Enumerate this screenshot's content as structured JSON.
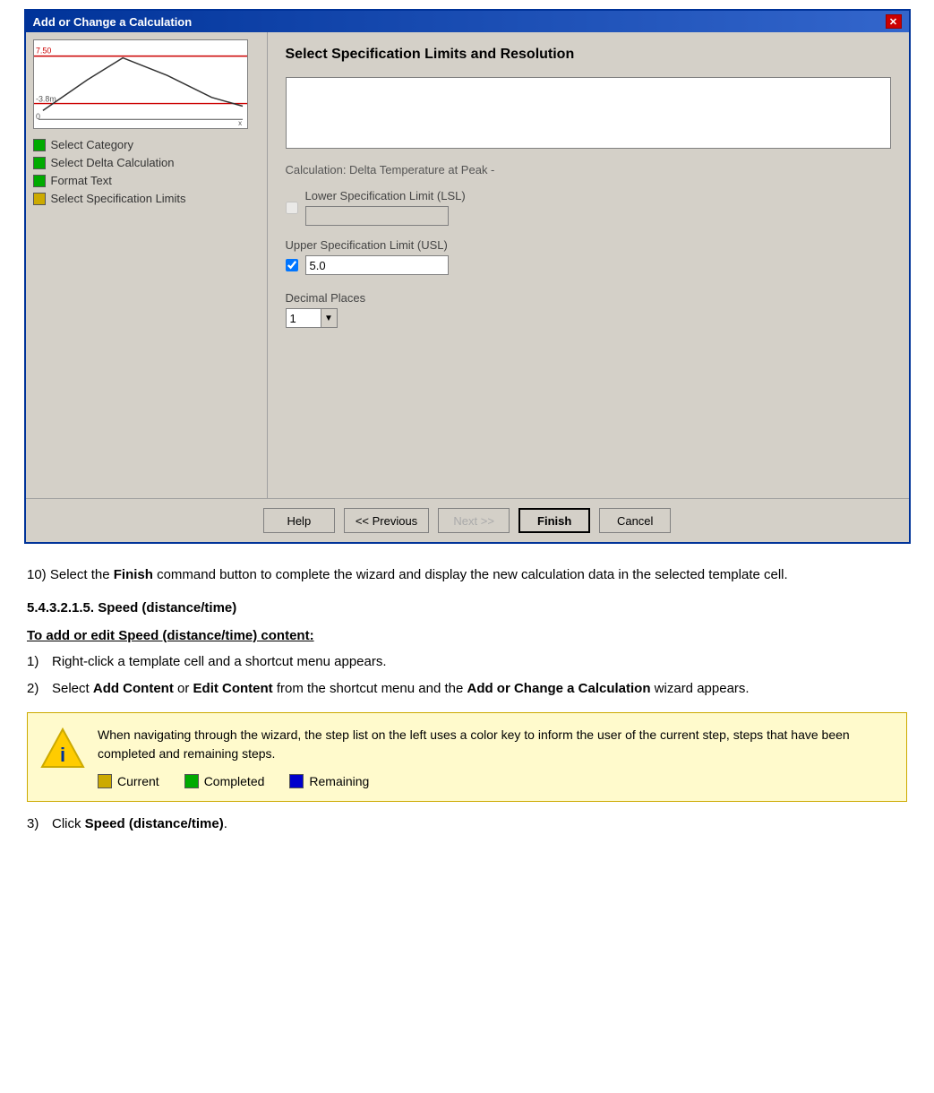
{
  "dialog": {
    "title": "Add or Change a Calculation",
    "close_label": "✕",
    "panel_title": "Select Specification Limits and Resolution",
    "calc_label": "Calculation: Delta Temperature at Peak -",
    "lsl_label": "Lower Specification Limit (LSL)",
    "usl_label": "Upper Specification Limit (USL)",
    "usl_value": "5.0",
    "decimal_label": "Decimal Places",
    "decimal_value": "1",
    "buttons": {
      "help": "Help",
      "previous": "<< Previous",
      "next": "Next >>",
      "finish": "Finish",
      "cancel": "Cancel"
    }
  },
  "sidebar": {
    "steps": [
      {
        "label": "Select Category",
        "color": "green"
      },
      {
        "label": "Select Delta Calculation",
        "color": "green"
      },
      {
        "label": "Format Text",
        "color": "green"
      },
      {
        "label": "Select Specification Limits",
        "color": "yellow"
      }
    ]
  },
  "content": {
    "step10_prefix": "10)",
    "step10_text_before": "Select the ",
    "step10_bold": "Finish",
    "step10_text_after": " command button to complete the wizard and display the new calculation data in the selected template cell.",
    "section_heading": "5.4.3.2.1.5. Speed (distance/time)",
    "subheading": "To add or edit Speed (distance/time) content:",
    "steps": [
      {
        "num": "1)",
        "text": "Right-click a template cell and a shortcut menu appears."
      },
      {
        "num": "2)",
        "text_before": "Select ",
        "bold1": "Add Content",
        "text_mid": " or ",
        "bold2": "Edit Content",
        "text_mid2": " from the shortcut menu and the ",
        "bold3": "Add or Change a Calculation",
        "text_after": " wizard appears."
      }
    ],
    "note_text": "When navigating through the wizard, the step list on the left uses a color key to inform the user of the current step, steps that have been completed and remaining steps.",
    "color_key": [
      {
        "label": "Current",
        "color": "yellow"
      },
      {
        "label": "Completed",
        "color": "green"
      },
      {
        "label": "Remaining",
        "color": "blue"
      }
    ],
    "step3_num": "3)",
    "step3_text_before": "Click ",
    "step3_bold": "Speed (distance/time)",
    "step3_text_after": "."
  }
}
